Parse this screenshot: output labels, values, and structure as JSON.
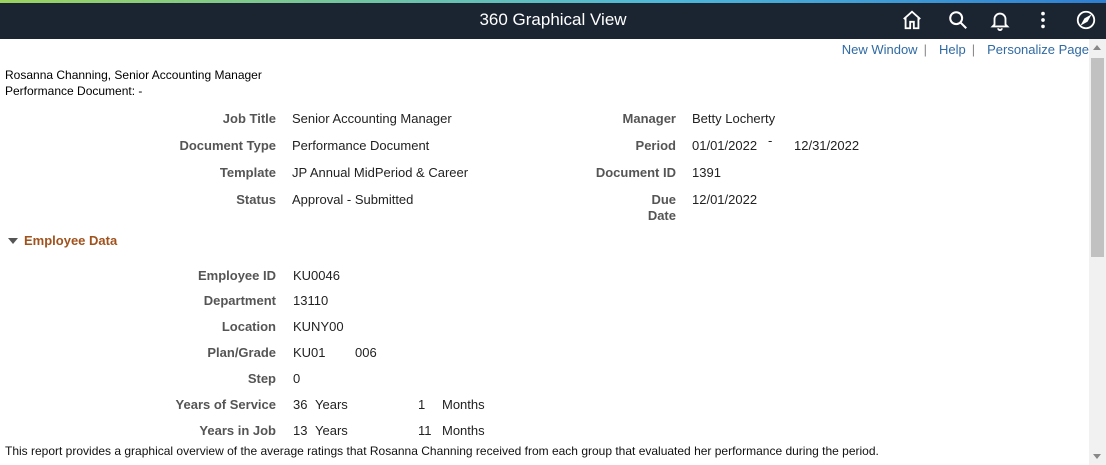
{
  "header": {
    "title": "360 Graphical View",
    "icons": [
      "home-icon",
      "search-icon",
      "bell-icon",
      "more-vertical-icon",
      "compass-icon"
    ]
  },
  "links": {
    "new_window": "New Window",
    "help": "Help",
    "personalize": "Personalize Page"
  },
  "employee_header": {
    "name_title": "Rosanna Channing, Senior Accounting Manager",
    "doc_line": "Performance Document: -"
  },
  "document": {
    "job_title_label": "Job Title",
    "job_title": "Senior Accounting Manager",
    "document_type_label": "Document Type",
    "document_type": "Performance Document",
    "template_label": "Template",
    "template": "JP Annual MidPeriod & Career",
    "status_label": "Status",
    "status": "Approval - Submitted",
    "manager_label": "Manager",
    "manager": "Betty Locherty",
    "period_label": "Period",
    "period_start": "01/01/2022",
    "period_sep": "-",
    "period_end": "12/31/2022",
    "document_id_label": "Document ID",
    "document_id": "1391",
    "due_label_1": "Due",
    "due_label_2": "Date",
    "due_date": "12/01/2022"
  },
  "employee_data": {
    "section_title": "Employee Data",
    "employee_id_label": "Employee ID",
    "employee_id": "KU0046",
    "department_label": "Department",
    "department": "13110",
    "location_label": "Location",
    "location": "KUNY00",
    "plan_grade_label": "Plan/Grade",
    "plan": "KU01",
    "grade": "006",
    "step_label": "Step",
    "step": "0",
    "years_service_label": "Years of Service",
    "years_service_years": "36",
    "years_unit": "Years",
    "years_service_months": "1",
    "months_unit": "Months",
    "years_job_label": "Years in Job",
    "years_job_years": "13",
    "years_job_months": "11"
  },
  "footer": {
    "report_text": "This report provides a graphical overview of the average ratings that Rosanna Channing received from each group that evaluated her performance during the period."
  }
}
